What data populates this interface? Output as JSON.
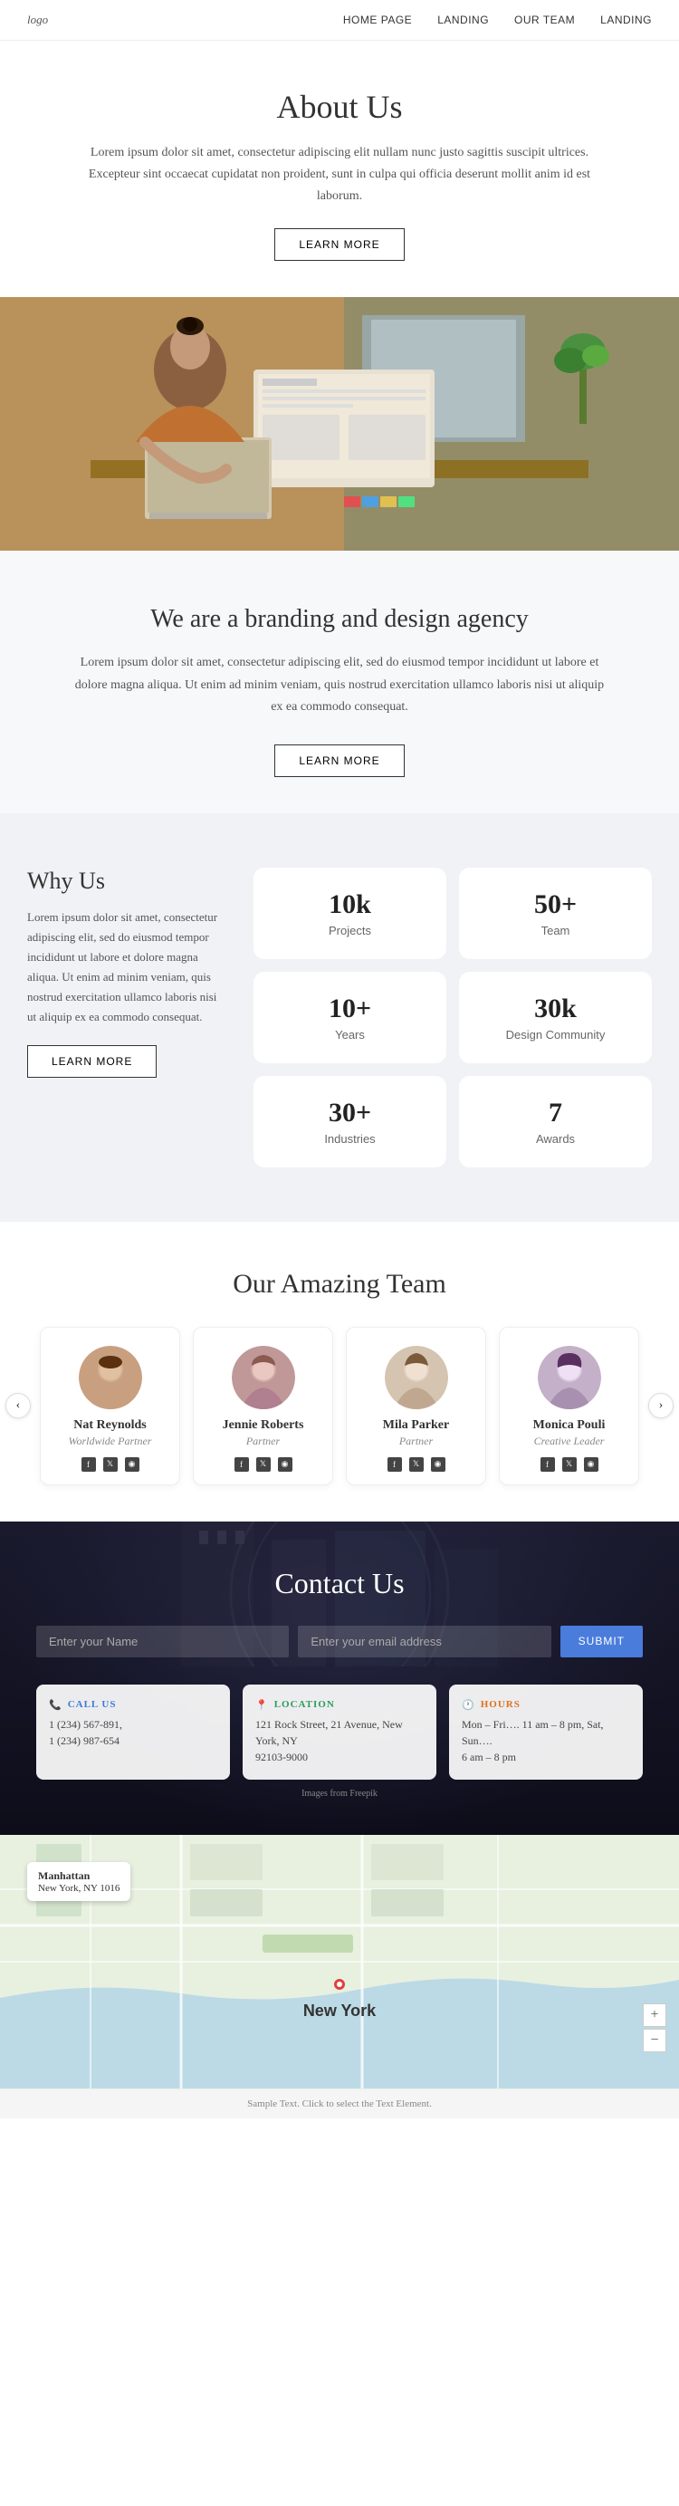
{
  "nav": {
    "logo": "logo",
    "links": [
      {
        "label": "HOME PAGE",
        "href": "#"
      },
      {
        "label": "LANDING",
        "href": "#"
      },
      {
        "label": "OUR TEAM",
        "href": "#"
      },
      {
        "label": "LANDING",
        "href": "#"
      }
    ]
  },
  "about": {
    "title": "About Us",
    "description": "Lorem ipsum dolor sit amet, consectetur adipiscing elit nullam nunc justo sagittis suscipit ultrices. Excepteur sint occaecat cupidatat non proident, sunt in culpa qui officia deserunt mollit anim id est laborum.",
    "button_label": "LEARN MORE"
  },
  "branding": {
    "title": "We are a branding and design agency",
    "description": "Lorem ipsum dolor sit amet, consectetur adipiscing elit, sed do eiusmod tempor incididunt ut labore et dolore magna aliqua. Ut enim ad minim veniam, quis nostrud exercitation ullamco laboris nisi ut aliquip ex ea commodo consequat.",
    "button_label": "LEARN MORE"
  },
  "why_us": {
    "title": "Why Us",
    "description": "Lorem ipsum dolor sit amet, consectetur adipiscing elit, sed do eiusmod tempor incididunt ut labore et dolore magna aliqua. Ut enim ad minim veniam, quis nostrud exercitation ullamco laboris nisi ut aliquip ex ea commodo consequat.",
    "button_label": "LEARN MORE",
    "stats": [
      {
        "number": "10k",
        "label": "Projects"
      },
      {
        "number": "50+",
        "label": "Team"
      },
      {
        "number": "10+",
        "label": "Years"
      },
      {
        "number": "30k",
        "label": "Design Community"
      },
      {
        "number": "30+",
        "label": "Industries"
      },
      {
        "number": "7",
        "label": "Awards"
      }
    ]
  },
  "team": {
    "title": "Our Amazing Team",
    "members": [
      {
        "name": "Nat Reynolds",
        "role": "Worldwide Partner"
      },
      {
        "name": "Jennie Roberts",
        "role": "Partner"
      },
      {
        "name": "Mila Parker",
        "role": "Partner"
      },
      {
        "name": "Monica Pouli",
        "role": "Creative Leader"
      }
    ]
  },
  "contact": {
    "title": "Contact Us",
    "form": {
      "name_placeholder": "Enter your Name",
      "email_placeholder": "Enter your email address",
      "submit_label": "SUBMIT"
    },
    "cards": [
      {
        "icon": "📞",
        "title": "CALL US",
        "color": "blue",
        "lines": [
          "1 (234) 567-891,",
          "1 (234) 987-654"
        ]
      },
      {
        "icon": "📍",
        "title": "LOCATION",
        "color": "green",
        "lines": [
          "121 Rock Street, 21 Avenue, New York, NY",
          "92103-9000"
        ]
      },
      {
        "icon": "🕐",
        "title": "HOURS",
        "color": "orange",
        "lines": [
          "Mon – Fri…. 11 am – 8 pm, Sat, Sun….",
          "6 am – 8 pm"
        ]
      }
    ],
    "freepik_note": "Images from Freepik"
  },
  "map": {
    "location_name": "Manhattan",
    "location_sub": "New York, NY 1016",
    "label": "New York",
    "zoom_in": "+",
    "zoom_out": "−"
  },
  "footer": {
    "note": "Sample Text. Click to select the Text Element."
  }
}
